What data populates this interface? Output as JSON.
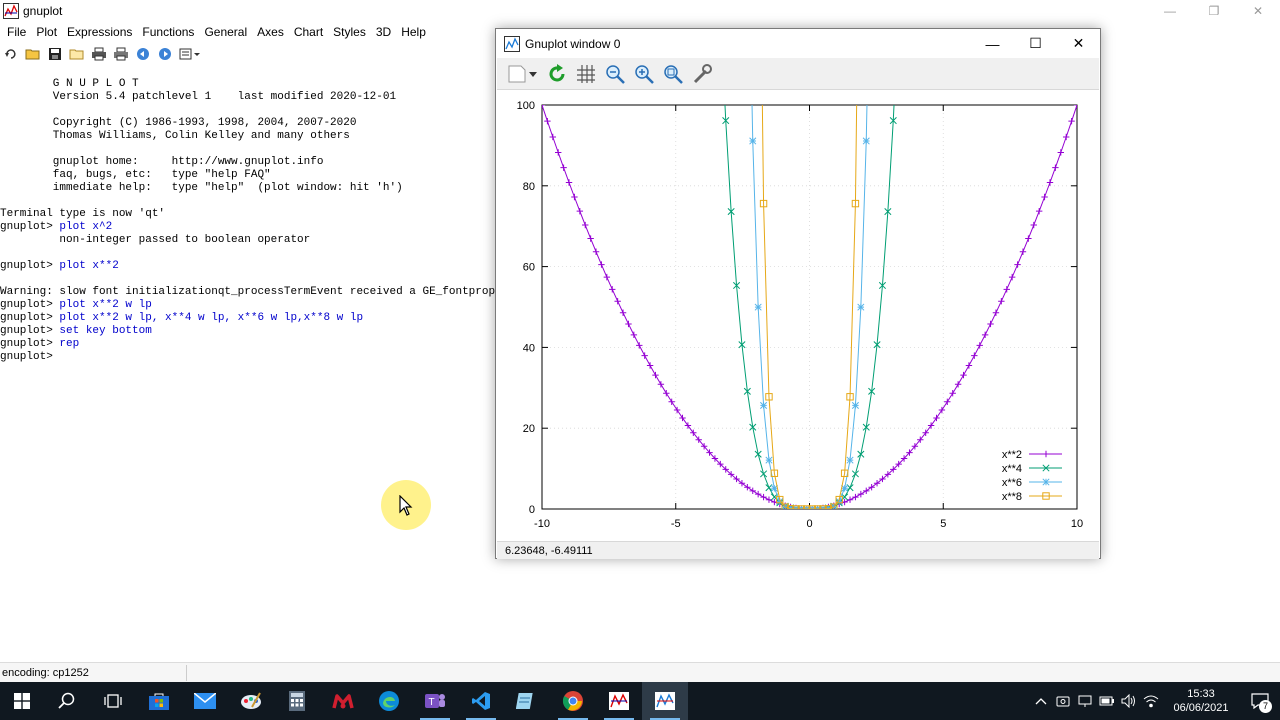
{
  "window": {
    "title": "gnuplot",
    "controls": {
      "minimize": "—",
      "restore": "❐",
      "close": "✕"
    }
  },
  "menubar": {
    "items": [
      "File",
      "Plot",
      "Expressions",
      "Functions",
      "General",
      "Axes",
      "Chart",
      "Styles",
      "3D",
      "Help"
    ]
  },
  "toolbar": {
    "icons": [
      "replot-icon",
      "open-icon",
      "save-icon",
      "change-dir-icon",
      "print-icon",
      "print-setup-icon",
      "back-icon",
      "forward-icon",
      "options-icon"
    ]
  },
  "console": {
    "lines": [
      {
        "text": "        G N U P L O T",
        "kind": "out"
      },
      {
        "text": "        Version 5.4 patchlevel 1    last modified 2020-12-01",
        "kind": "out"
      },
      {
        "text": "",
        "kind": "out"
      },
      {
        "text": "        Copyright (C) 1986-1993, 1998, 2004, 2007-2020",
        "kind": "out"
      },
      {
        "text": "        Thomas Williams, Colin Kelley and many others",
        "kind": "out"
      },
      {
        "text": "",
        "kind": "out"
      },
      {
        "text": "        gnuplot home:     http://www.gnuplot.info",
        "kind": "out"
      },
      {
        "text": "        faq, bugs, etc:   type \"help FAQ\"",
        "kind": "out"
      },
      {
        "text": "        immediate help:   type \"help\"  (plot window: hit 'h')",
        "kind": "out"
      },
      {
        "text": "",
        "kind": "out"
      },
      {
        "text": "Terminal type is now 'qt'",
        "kind": "out"
      },
      {
        "prompt": "gnuplot> ",
        "cmd": "plot x^2",
        "kind": "cmd"
      },
      {
        "text": "         non-integer passed to boolean operator",
        "kind": "out"
      },
      {
        "text": "",
        "kind": "out"
      },
      {
        "prompt": "gnuplot> ",
        "cmd": "plot x**2",
        "kind": "cmd"
      },
      {
        "text": "",
        "kind": "out"
      },
      {
        "text": "Warning: slow font initializationqt_processTermEvent received a GE_fontprops",
        "kind": "out"
      },
      {
        "prompt": "gnuplot> ",
        "cmd": "plot x**2 w lp",
        "kind": "cmd"
      },
      {
        "prompt": "gnuplot> ",
        "cmd": "plot x**2 w lp, x**4 w lp, x**6 w lp,x**8 w lp",
        "kind": "cmd"
      },
      {
        "prompt": "gnuplot> ",
        "cmd": "set key bottom",
        "kind": "cmd"
      },
      {
        "prompt": "gnuplot> ",
        "cmd": "rep",
        "kind": "cmd"
      },
      {
        "prompt": "gnuplot> ",
        "cmd": "",
        "kind": "cmd"
      }
    ]
  },
  "statusbar": {
    "text": "encoding: cp1252"
  },
  "plot_window": {
    "title": "Gnuplot window 0",
    "controls": {
      "minimize": "—",
      "maximize": "☐",
      "close": "✕"
    },
    "tools": [
      "export-icon",
      "replot-icon",
      "grid-icon",
      "zoom-prev-icon",
      "zoom-next-icon",
      "unzoom-icon",
      "settings-icon"
    ],
    "status": "6.23648, -6.49111"
  },
  "chart_data": {
    "type": "line",
    "xlim": [
      -10,
      10
    ],
    "ylim": [
      0,
      100
    ],
    "xticks": [
      -10,
      -5,
      0,
      5,
      10
    ],
    "yticks": [
      0,
      20,
      40,
      60,
      80,
      100
    ],
    "grid": true,
    "legend_position": "bottom-right",
    "samples": 100,
    "series": [
      {
        "name": "x**2",
        "exponent": 2,
        "color": "#9400d3",
        "marker": "plus"
      },
      {
        "name": "x**4",
        "exponent": 4,
        "color": "#009e73",
        "marker": "cross"
      },
      {
        "name": "x**6",
        "exponent": 6,
        "color": "#56b4e9",
        "marker": "star"
      },
      {
        "name": "x**8",
        "exponent": 8,
        "color": "#e6a817",
        "marker": "square"
      }
    ]
  },
  "taskbar": {
    "apps": [
      "search-icon",
      "task-view-icon",
      "store-icon",
      "mail-icon",
      "paint-icon",
      "calculator-icon",
      "mendeley-icon",
      "edge-icon",
      "teams-icon",
      "vscode-icon",
      "notepad-icon",
      "chrome-icon",
      "gnuplot-console-icon",
      "gnuplot-window-icon"
    ],
    "time": "15:33",
    "date": "06/06/2021",
    "notifications": "7"
  }
}
